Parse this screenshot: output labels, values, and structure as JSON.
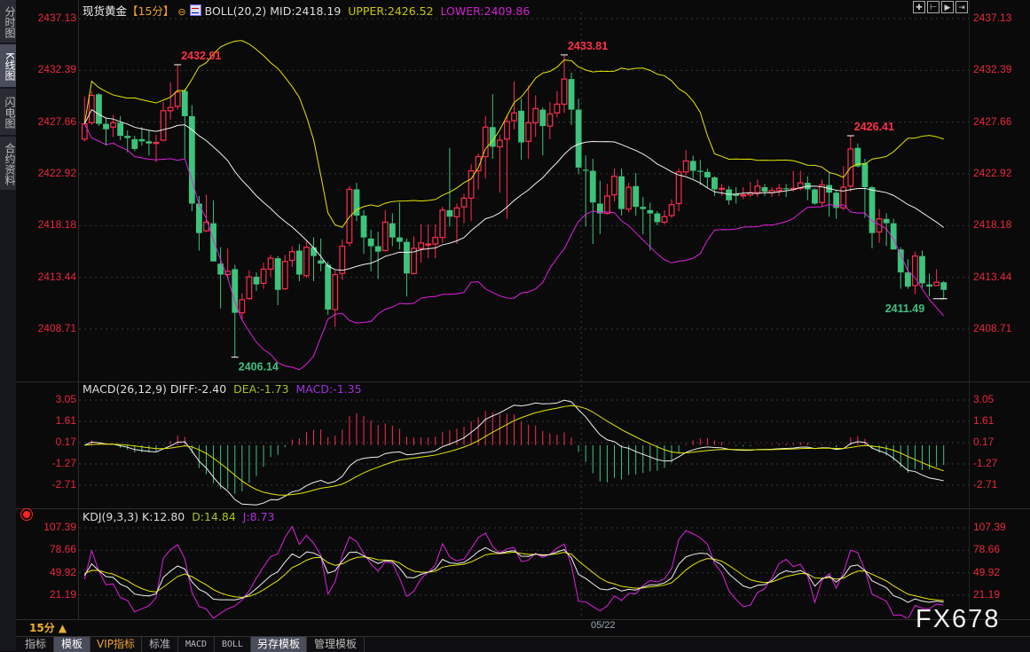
{
  "sidebar": {
    "tabs": [
      {
        "label": "分时图",
        "active": false
      },
      {
        "label": "K线图",
        "active": true
      },
      {
        "label": "闪电图",
        "active": false
      },
      {
        "label": "合约资料",
        "active": false
      }
    ]
  },
  "header": {
    "instrument": "现货黄金",
    "period_bracket": "【15分】",
    "indicator": "BOLL(20,2) MID:2418.19",
    "upper": "UPPER:2426.52",
    "lower": "LOWER:2409.86"
  },
  "macd_header": {
    "name": "MACD(26,12,9) DIFF:-2.40",
    "dea": "DEA:-1.73",
    "macd": "MACD:-1.35"
  },
  "kdj_header": {
    "name": "KDJ(9,3,3) K:12.80",
    "d": "D:14.84",
    "j": "J:8.73"
  },
  "toolbar": {
    "icons": [
      "crosshair-icon",
      "zoom-range-icon",
      "play-icon",
      "move-right-icon"
    ]
  },
  "period_selector": "15分 ▲",
  "bottom_tabs": [
    {
      "label": "指标",
      "style": ""
    },
    {
      "label": "模板",
      "style": "active"
    },
    {
      "label": "VIP指标",
      "style": "vip"
    },
    {
      "label": "标准",
      "style": ""
    },
    {
      "label": "MACD",
      "style": "mono"
    },
    {
      "label": "BOLL",
      "style": "mono"
    },
    {
      "label": "另存模板",
      "style": "active"
    },
    {
      "label": "管理模板",
      "style": ""
    }
  ],
  "watermark": "FX678",
  "colors": {
    "up": "#ff2d4f",
    "down": "#3cc47c",
    "mid": "#f0f0f0",
    "upper": "#e6e600",
    "lower": "#e020e0",
    "axis": "#e8283c"
  },
  "chart_data": [
    {
      "type": "candlestick",
      "title": "现货黄金 15分 BOLL(20,2)",
      "ylim": [
        2408.71,
        2437.13
      ],
      "yticks": [
        "2437.13",
        "2432.39",
        "2427.66",
        "2422.92",
        "2418.18",
        "2413.44",
        "2408.71"
      ],
      "x_labels": [
        {
          "index": 70,
          "label": "05/22"
        }
      ],
      "annotations": [
        {
          "index": 13,
          "price": 2432.91,
          "text": "2432.91",
          "kind": "high"
        },
        {
          "index": 67,
          "price": 2433.81,
          "text": "2433.81",
          "kind": "high"
        },
        {
          "index": 107,
          "price": 2426.41,
          "text": "2426.41",
          "kind": "high"
        },
        {
          "index": 21,
          "price": 2406.14,
          "text": "2406.14",
          "kind": "low"
        },
        {
          "index": 120,
          "price": 2411.49,
          "text": "2411.49",
          "kind": "low"
        }
      ],
      "ohlc": [
        [
          2426.1,
          2430.0,
          2425.9,
          2427.5
        ],
        [
          2427.6,
          2430.5,
          2427.4,
          2430.1
        ],
        [
          2430.2,
          2430.3,
          2427.3,
          2427.5
        ],
        [
          2427.5,
          2428.0,
          2425.5,
          2427.0
        ],
        [
          2427.2,
          2428.3,
          2426.3,
          2427.6
        ],
        [
          2427.6,
          2428.2,
          2426.0,
          2426.4
        ],
        [
          2426.4,
          2426.9,
          2424.9,
          2426.2
        ],
        [
          2426.1,
          2426.4,
          2425.0,
          2425.2
        ],
        [
          2426.1,
          2427.2,
          2425.5,
          2425.9
        ],
        [
          2425.9,
          2426.9,
          2424.6,
          2425.7
        ],
        [
          2425.7,
          2426.5,
          2424.0,
          2425.8
        ],
        [
          2426.0,
          2429.5,
          2425.9,
          2428.7
        ],
        [
          2428.7,
          2431.3,
          2427.9,
          2429.0
        ],
        [
          2429.1,
          2432.91,
          2428.8,
          2430.4
        ],
        [
          2430.5,
          2430.7,
          2424.3,
          2428.2
        ],
        [
          2428.2,
          2429.2,
          2419.5,
          2420.2
        ],
        [
          2420.2,
          2420.9,
          2415.9,
          2417.5
        ],
        [
          2417.7,
          2421.0,
          2417.6,
          2418.5
        ],
        [
          2418.4,
          2420.5,
          2414.9,
          2414.9
        ],
        [
          2414.7,
          2416.2,
          2410.6,
          2413.7
        ],
        [
          2413.7,
          2416.1,
          2413.3,
          2414.0
        ],
        [
          2414.2,
          2414.6,
          2406.14,
          2410.2
        ],
        [
          2410.2,
          2412.0,
          2409.6,
          2411.4
        ],
        [
          2411.5,
          2414.1,
          2411.4,
          2413.5
        ],
        [
          2413.5,
          2413.9,
          2412.2,
          2412.8
        ],
        [
          2412.9,
          2414.8,
          2412.4,
          2414.2
        ],
        [
          2414.2,
          2415.5,
          2413.5,
          2415.2
        ],
        [
          2415.2,
          2415.4,
          2410.9,
          2412.3
        ],
        [
          2412.4,
          2415.5,
          2412.3,
          2414.9
        ],
        [
          2415.0,
          2416.3,
          2414.4,
          2415.8
        ],
        [
          2415.9,
          2416.5,
          2413.1,
          2413.7
        ],
        [
          2413.6,
          2416.7,
          2413.4,
          2416.2
        ],
        [
          2416.2,
          2417.1,
          2413.1,
          2415.4
        ],
        [
          2415.0,
          2417.0,
          2414.0,
          2414.7
        ],
        [
          2414.6,
          2414.9,
          2410.0,
          2410.5
        ],
        [
          2410.5,
          2414.1,
          2408.9,
          2413.7
        ],
        [
          2413.8,
          2416.9,
          2413.2,
          2416.3
        ],
        [
          2416.6,
          2421.8,
          2416.3,
          2421.5
        ],
        [
          2421.5,
          2422.1,
          2418.6,
          2419.1
        ],
        [
          2419.1,
          2419.6,
          2415.6,
          2417.1
        ],
        [
          2417.0,
          2417.8,
          2414.0,
          2416.3
        ],
        [
          2416.3,
          2417.6,
          2413.3,
          2415.8
        ],
        [
          2415.9,
          2419.6,
          2415.8,
          2418.5
        ],
        [
          2418.4,
          2419.3,
          2416.3,
          2417.1
        ],
        [
          2417.1,
          2420.3,
          2416.0,
          2416.7
        ],
        [
          2416.7,
          2417.0,
          2411.7,
          2413.8
        ],
        [
          2413.8,
          2417.2,
          2413.7,
          2416.1
        ],
        [
          2416.1,
          2418.3,
          2414.8,
          2416.6
        ],
        [
          2416.4,
          2418.3,
          2415.2,
          2416.5
        ],
        [
          2416.5,
          2418.3,
          2415.2,
          2417.1
        ],
        [
          2417.1,
          2419.9,
          2416.6,
          2419.6
        ],
        [
          2419.6,
          2425.3,
          2418.1,
          2419.0
        ],
        [
          2419.0,
          2420.2,
          2416.5,
          2419.8
        ],
        [
          2419.9,
          2421.1,
          2418.4,
          2420.7
        ],
        [
          2420.7,
          2423.8,
          2418.6,
          2423.2
        ],
        [
          2423.2,
          2424.8,
          2421.5,
          2424.5
        ],
        [
          2424.5,
          2428.2,
          2422.5,
          2427.2
        ],
        [
          2427.2,
          2430.2,
          2424.3,
          2425.4
        ],
        [
          2425.4,
          2426.5,
          2421.2,
          2426.0
        ],
        [
          2426.1,
          2428.3,
          2418.8,
          2427.7
        ],
        [
          2427.8,
          2431.4,
          2427.0,
          2428.5
        ],
        [
          2428.7,
          2429.8,
          2424.2,
          2425.8
        ],
        [
          2425.9,
          2431.0,
          2424.3,
          2427.6
        ],
        [
          2427.6,
          2430.1,
          2426.3,
          2428.9
        ],
        [
          2428.8,
          2429.0,
          2424.6,
          2427.3
        ],
        [
          2427.3,
          2429.5,
          2426.1,
          2428.4
        ],
        [
          2428.5,
          2430.5,
          2428.1,
          2429.3
        ],
        [
          2429.3,
          2433.81,
          2428.5,
          2431.6
        ],
        [
          2431.6,
          2432.2,
          2427.4,
          2428.8
        ],
        [
          2428.8,
          2429.8,
          2422.9,
          2423.5
        ],
        [
          2423.3,
          2424.6,
          2418.1,
          2423.2
        ],
        [
          2423.2,
          2424.3,
          2416.5,
          2420.3
        ],
        [
          2420.2,
          2422.3,
          2417.4,
          2419.3
        ],
        [
          2419.3,
          2422.0,
          2419.2,
          2420.9
        ],
        [
          2421.0,
          2423.4,
          2420.4,
          2422.7
        ],
        [
          2422.7,
          2423.4,
          2419.1,
          2419.7
        ],
        [
          2419.7,
          2422.1,
          2419.4,
          2421.7
        ],
        [
          2421.8,
          2423.0,
          2419.1,
          2419.9
        ],
        [
          2419.9,
          2420.8,
          2417.4,
          2419.7
        ],
        [
          2419.6,
          2420.3,
          2415.9,
          2419.3
        ],
        [
          2419.3,
          2419.5,
          2418.2,
          2418.5
        ],
        [
          2418.5,
          2419.6,
          2418.3,
          2419.0
        ],
        [
          2419.1,
          2420.6,
          2418.9,
          2420.1
        ],
        [
          2420.2,
          2423.4,
          2419.5,
          2423.1
        ],
        [
          2423.1,
          2425.1,
          2422.8,
          2424.1
        ],
        [
          2424.1,
          2424.6,
          2422.5,
          2423.2
        ],
        [
          2423.2,
          2424.2,
          2421.9,
          2423.1
        ],
        [
          2423.1,
          2423.4,
          2421.6,
          2422.6
        ],
        [
          2422.6,
          2422.7,
          2420.9,
          2421.5
        ],
        [
          2421.5,
          2422.0,
          2420.9,
          2421.6
        ],
        [
          2421.5,
          2421.8,
          2420.1,
          2420.5
        ],
        [
          2421.1,
          2421.7,
          2420.2,
          2420.9
        ],
        [
          2420.9,
          2421.7,
          2420.6,
          2421.0
        ],
        [
          2421.0,
          2422.2,
          2420.8,
          2421.2
        ],
        [
          2421.2,
          2422.4,
          2420.8,
          2421.8
        ],
        [
          2421.7,
          2422.0,
          2420.9,
          2421.3
        ],
        [
          2421.2,
          2421.7,
          2420.8,
          2421.4
        ],
        [
          2421.4,
          2422.0,
          2420.9,
          2421.6
        ],
        [
          2421.6,
          2422.0,
          2420.8,
          2421.5
        ],
        [
          2421.5,
          2423.2,
          2421.3,
          2421.6
        ],
        [
          2421.6,
          2423.2,
          2421.4,
          2422.1
        ],
        [
          2422.1,
          2422.7,
          2420.5,
          2421.5
        ],
        [
          2421.5,
          2421.6,
          2420.1,
          2420.2
        ],
        [
          2420.3,
          2422.4,
          2419.9,
          2421.9
        ],
        [
          2421.9,
          2423.1,
          2419.0,
          2421.2
        ],
        [
          2421.2,
          2421.4,
          2418.8,
          2419.8
        ],
        [
          2419.8,
          2423.6,
          2419.6,
          2421.7
        ],
        [
          2421.8,
          2426.41,
          2421.3,
          2425.2
        ],
        [
          2425.3,
          2425.7,
          2423.5,
          2423.6
        ],
        [
          2423.9,
          2424.3,
          2418.9,
          2421.7
        ],
        [
          2421.7,
          2421.8,
          2416.1,
          2417.5
        ],
        [
          2417.6,
          2419.7,
          2416.6,
          2418.8
        ],
        [
          2418.8,
          2419.3,
          2416.3,
          2418.4
        ],
        [
          2418.4,
          2418.8,
          2416.0,
          2416.0
        ],
        [
          2416.0,
          2416.2,
          2412.4,
          2413.9
        ],
        [
          2413.9,
          2415.1,
          2412.4,
          2412.6
        ],
        [
          2412.7,
          2415.8,
          2411.9,
          2415.4
        ],
        [
          2415.4,
          2415.9,
          2412.5,
          2412.9
        ],
        [
          2412.8,
          2413.8,
          2411.7,
          2412.6
        ],
        [
          2412.7,
          2414.2,
          2412.7,
          2413.0
        ],
        [
          2413.0,
          2413.1,
          2411.49,
          2412.3
        ]
      ],
      "indicator": {
        "name": "BOLL",
        "period": 20,
        "k": 2
      }
    },
    {
      "type": "line",
      "title": "MACD(26,12,9)",
      "ylim": [
        -2.71,
        3.05
      ],
      "yticks": [
        "3.05",
        "1.61",
        "0.17",
        "-1.27",
        "-2.71"
      ],
      "series": [
        "DIFF",
        "DEA",
        "MACD"
      ]
    },
    {
      "type": "line",
      "title": "KDJ(9,3,3)",
      "ylim": [
        21.19,
        107.39
      ],
      "yticks": [
        "107.39",
        "78.66",
        "49.92",
        "21.19"
      ],
      "series": [
        "K",
        "D",
        "J"
      ]
    }
  ]
}
